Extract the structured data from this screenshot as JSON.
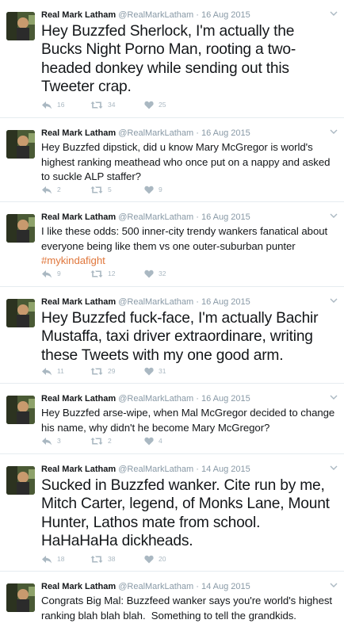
{
  "colors": {
    "text": "#14171a",
    "muted": "#8899a6",
    "hashtag": "#e0773c",
    "icon": "#aab8c2",
    "divider": "#e6ecf0"
  },
  "icons": {
    "reply": "reply-arrow-icon",
    "retweet": "retweet-arrows-icon",
    "like": "heart-icon",
    "menu": "chevron-down-icon"
  },
  "tweets": [
    {
      "name": "Real Mark Latham",
      "handle": "@RealMarkLatham",
      "date": "16 Aug 2015",
      "text": "Hey Buzzfed Sherlock, I'm actually the Bucks Night Porno Man, rooting a two-headed donkey while sending out this Tweeter crap.",
      "replies": "16",
      "retweets": "34",
      "likes": "25"
    },
    {
      "name": "Real Mark Latham",
      "handle": "@RealMarkLatham",
      "date": "16 Aug 2015",
      "text": "Hey Buzzfed dipstick, did u know Mary McGregor is world's highest ranking meathead who once put on a nappy and asked to suckle ALP staffer?",
      "replies": "2",
      "retweets": "5",
      "likes": "9"
    },
    {
      "name": "Real Mark Latham",
      "handle": "@RealMarkLatham",
      "date": "16 Aug 2015",
      "text": "I like these odds: 500 inner-city trendy wankers fanatical about everyone being like them vs one outer-suburban punter ",
      "hashtag": "#mykindafight",
      "replies": "9",
      "retweets": "12",
      "likes": "32"
    },
    {
      "name": "Real Mark Latham",
      "handle": "@RealMarkLatham",
      "date": "16 Aug 2015",
      "text": "Hey Buzzfed fuck-face, I'm actually Bachir Mustaffa, taxi driver extraordinare, writing these Tweets with my one good arm.",
      "replies": "11",
      "retweets": "29",
      "likes": "31"
    },
    {
      "name": "Real Mark Latham",
      "handle": "@RealMarkLatham",
      "date": "16 Aug 2015",
      "text": "Hey Buzzfed arse-wipe, when Mal McGregor decided to change his name, why didn't he become Mary McGregor?",
      "replies": "3",
      "retweets": "2",
      "likes": "4"
    },
    {
      "name": "Real Mark Latham",
      "handle": "@RealMarkLatham",
      "date": "14 Aug 2015",
      "text": "Sucked in Buzzfed wanker. Cite run by me, Mitch Carter, legend, of Monks Lane, Mount Hunter, Lathos mate from school. HaHaHaHa dickheads.",
      "replies": "18",
      "retweets": "38",
      "likes": "20"
    },
    {
      "name": "Real Mark Latham",
      "handle": "@RealMarkLatham",
      "date": "14 Aug 2015",
      "text": "Congrats Big Mal: Buzzfeed wanker says you're world's highest ranking blah blah blah.  Something to tell the grandkids."
    }
  ]
}
